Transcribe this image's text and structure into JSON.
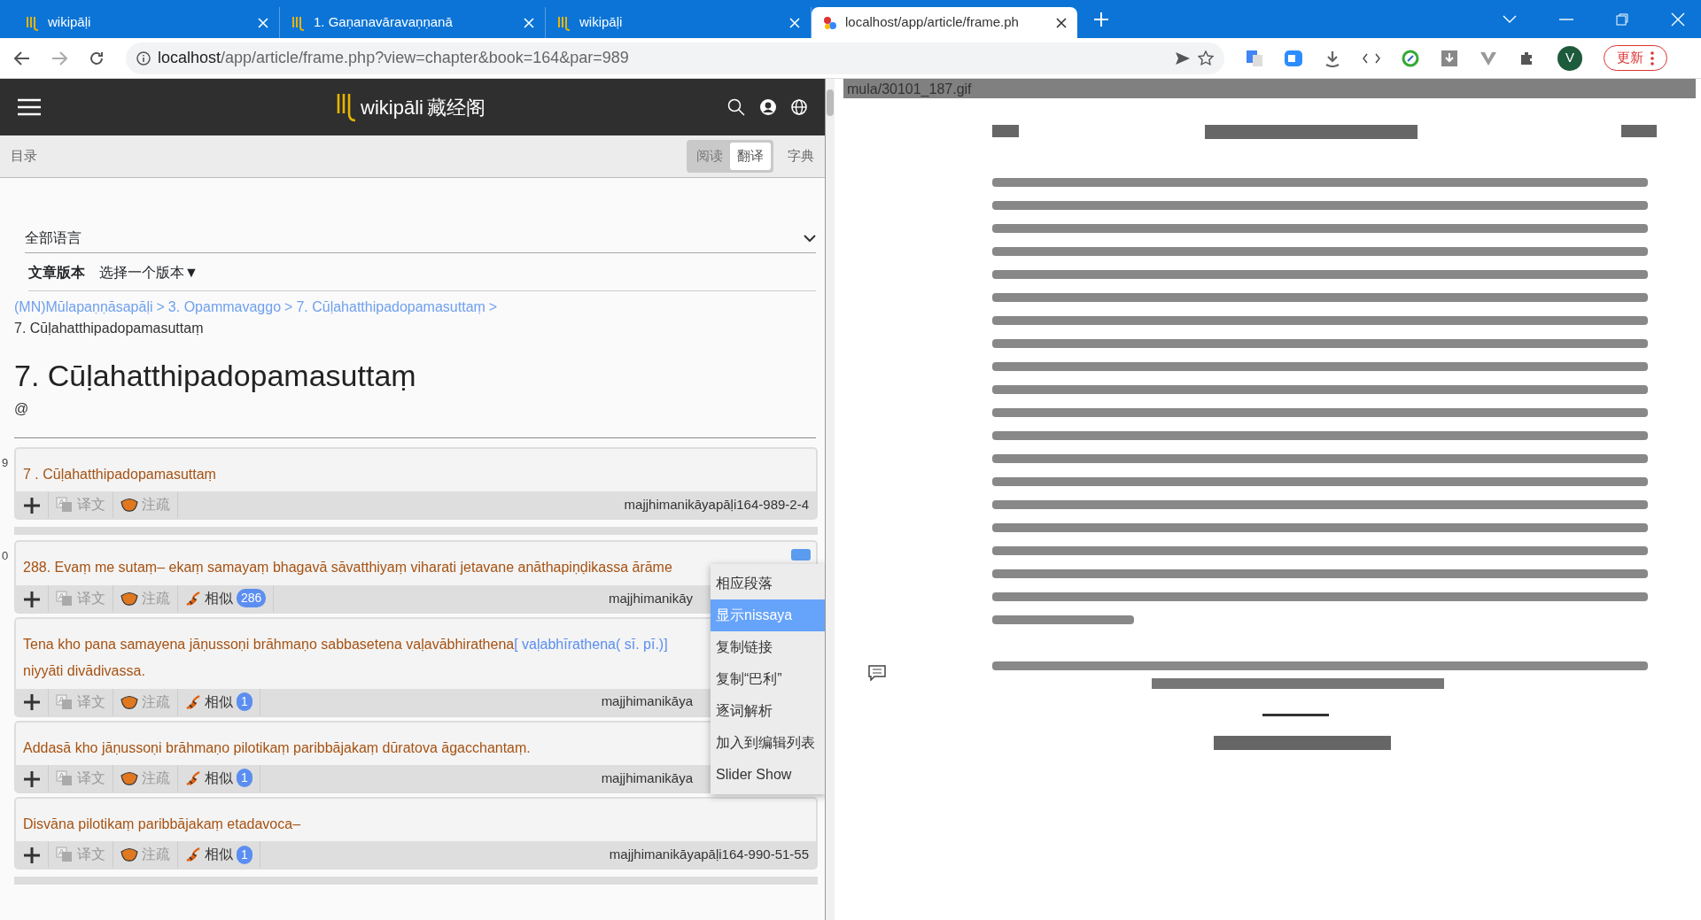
{
  "browser": {
    "tabs": [
      {
        "title": "wikipāḷi",
        "selected": false,
        "kind": "wiki"
      },
      {
        "title": "1. Gaṇanavāravaṇṇanā",
        "selected": false,
        "kind": "wiki"
      },
      {
        "title": "wikipāḷi",
        "selected": false,
        "kind": "wiki"
      },
      {
        "title": "localhost/app/article/frame.ph",
        "selected": true,
        "kind": "local"
      }
    ],
    "url_host": "localhost",
    "url_path": "/app/article/frame.php?view=chapter&book=164&par=989",
    "profile_initial": "V",
    "update_button": "更新"
  },
  "app": {
    "brand": "wikipāli",
    "brand_cn": "藏经阁"
  },
  "toolbar": {
    "toc": "目录",
    "modes": [
      {
        "label": "阅读",
        "selected": false
      },
      {
        "label": "翻译",
        "selected": true
      }
    ],
    "dictionary": "字典"
  },
  "language_select": "全部语言",
  "version": {
    "label": "文章版本",
    "picker": "选择一个版本▼"
  },
  "breadcrumb": {
    "links": [
      "(MN)Mūlapaṇṇāsapāḷi",
      "3. Opammavaggo",
      "7. Cūḷahatthipadopamasuttaṃ"
    ],
    "separator": ">",
    "current": "7. Cūḷahatthipadopamasuttaṃ"
  },
  "title": "7. Cūḷahatthipadopamasuttaṃ",
  "subtitle": "@",
  "paragraphs": [
    {
      "gutter": "9",
      "sentences": [
        {
          "segments": [
            {
              "kind": "pali",
              "text": "7 . Cūḷahatthipadopamasuttaṃ"
            }
          ],
          "actions": [
            "译文",
            "注疏"
          ],
          "ref": "majjhimanikāyapāḷi164-989-2-4",
          "menu_open": false
        }
      ]
    },
    {
      "gutter": "0",
      "sentences": [
        {
          "segments": [
            {
              "kind": "pali",
              "text": "288. Evaṃ me sutaṃ– ekaṃ samayaṃ bhagavā sāvatthiyaṃ viharati jetavane anāthapiṇḍikassa ārāme"
            }
          ],
          "actions": [
            "译文",
            "注疏"
          ],
          "similar": {
            "label": "相似",
            "count": "286"
          },
          "ref": "majjhimanikāy",
          "menu_open": true
        },
        {
          "segments": [
            {
              "kind": "pali",
              "text": "Tena kho pana samayena jāṇussoṇi brāhmaṇo sabbasetena vaḷavābhirathena"
            },
            {
              "kind": "variant",
              "text": "[ vaḷabhīrathena( sī. pī.)]"
            },
            {
              "kind": "break"
            },
            {
              "kind": "pali",
              "text": "niyyāti divādivassa."
            }
          ],
          "actions": [
            "译文",
            "注疏"
          ],
          "similar": {
            "label": "相似",
            "count": "1"
          },
          "ref": "majjhimanikāya",
          "menu_open": false
        },
        {
          "segments": [
            {
              "kind": "pali",
              "text": "Addasā kho jāṇussoṇi brāhmaṇo pilotikaṃ paribbājakaṃ dūratova āgacchantaṃ."
            }
          ],
          "actions": [
            "译文",
            "注疏"
          ],
          "similar": {
            "label": "相似",
            "count": "1"
          },
          "ref": "majjhimanikāya",
          "menu_open": false
        },
        {
          "segments": [
            {
              "kind": "pali",
              "text": "Disvāna pilotikaṃ paribbājakaṃ etadavoca–"
            }
          ],
          "actions": [
            "译文",
            "注疏"
          ],
          "similar": {
            "label": "相似",
            "count": "1"
          },
          "ref": "majjhimanikāyapāḷi164-990-51-55",
          "menu_open": false
        }
      ]
    }
  ],
  "context_menu": [
    {
      "label": "相应段落",
      "selected": false
    },
    {
      "label": "显示nissaya",
      "selected": true
    },
    {
      "label": "复制链接",
      "selected": false
    },
    {
      "label": "复制“巴利”",
      "selected": false
    },
    {
      "label": "逐词解析",
      "selected": false
    },
    {
      "label": "加入到编辑列表",
      "selected": false
    },
    {
      "label": "Slider Show",
      "selected": false
    }
  ],
  "image_pane": {
    "filename": "mula/30101_187.gif"
  }
}
